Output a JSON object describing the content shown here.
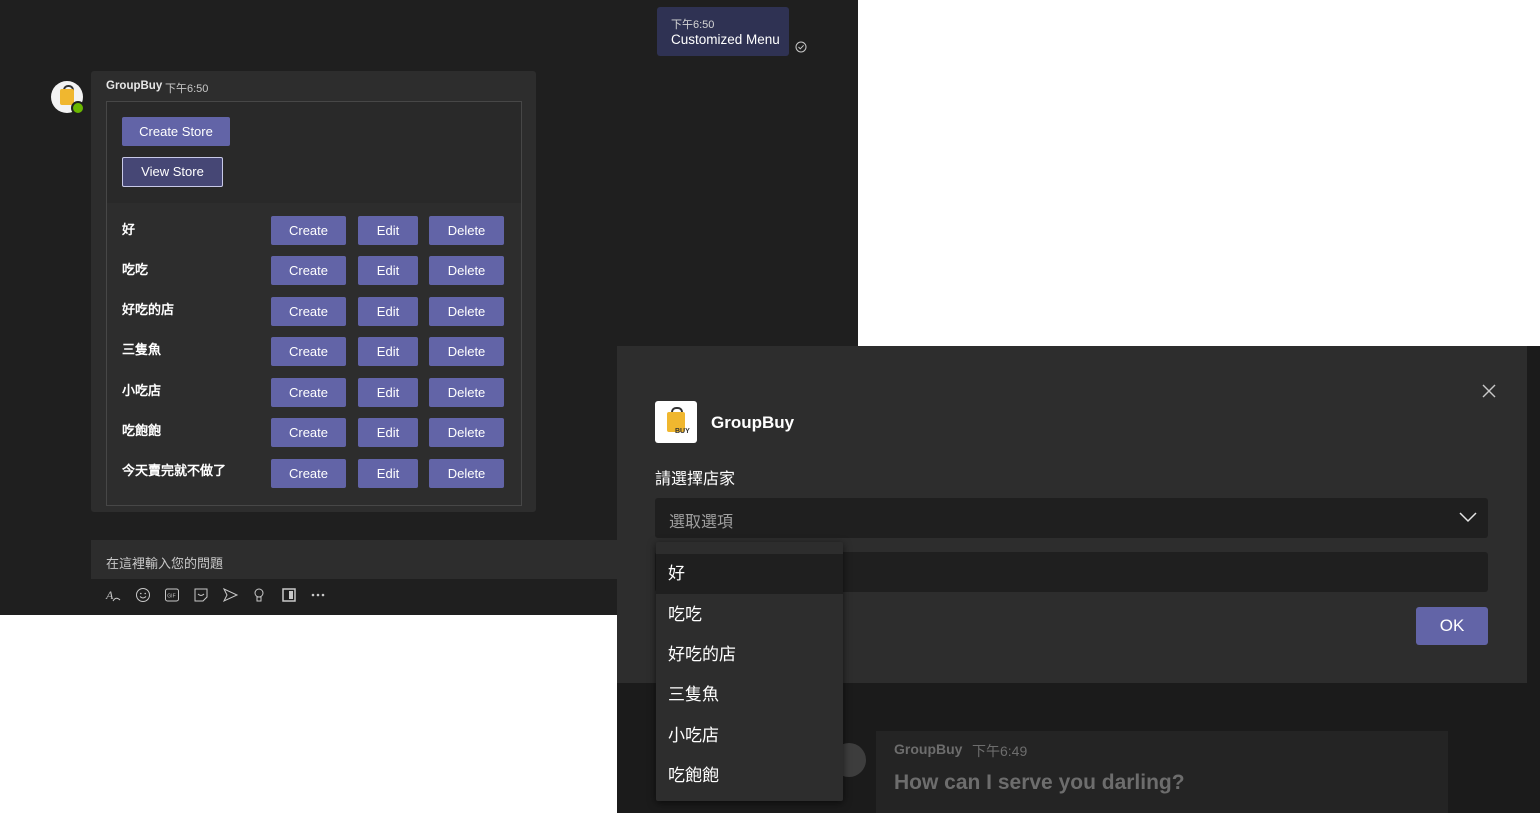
{
  "colors": {
    "accent": "#6264a7",
    "background": "#1f1f1f",
    "surface": "#2d2d2d",
    "status_online": "#6bb700"
  },
  "chat": {
    "sent_message": {
      "time": "下午6:50",
      "text": "Customized Menu",
      "status_icon": "read-check-icon"
    },
    "bot_message": {
      "sender": "GroupBuy",
      "time": "下午6:50",
      "card": {
        "create_store_label": "Create Store",
        "view_store_label": "View Store",
        "rows": [
          {
            "name": "好",
            "create": "Create",
            "edit": "Edit",
            "delete": "Delete"
          },
          {
            "name": "吃吃",
            "create": "Create",
            "edit": "Edit",
            "delete": "Delete"
          },
          {
            "name": "好吃的店",
            "create": "Create",
            "edit": "Edit",
            "delete": "Delete"
          },
          {
            "name": "三隻魚",
            "create": "Create",
            "edit": "Edit",
            "delete": "Delete"
          },
          {
            "name": "小吃店",
            "create": "Create",
            "edit": "Edit",
            "delete": "Delete"
          },
          {
            "name": "吃飽飽",
            "create": "Create",
            "edit": "Edit",
            "delete": "Delete"
          },
          {
            "name": "今天賣完就不做了",
            "create": "Create",
            "edit": "Edit",
            "delete": "Delete"
          }
        ]
      }
    },
    "compose": {
      "placeholder": "在這裡輸入您的問題"
    },
    "toolbar_icons": [
      "format-icon",
      "emoji-icon",
      "gif-icon",
      "sticker-icon",
      "meet-icon",
      "praise-icon",
      "app-icon",
      "more-options-icon"
    ]
  },
  "dialog": {
    "app_name": "GroupBuy",
    "icon_text": "BUY",
    "field_label": "請選擇店家",
    "select_placeholder": "選取選項",
    "ok_label": "OK",
    "options": [
      "好",
      "吃吃",
      "好吃的店",
      "三隻魚",
      "小吃店",
      "吃飽飽"
    ],
    "selected_option": "好"
  },
  "background_message": {
    "sender": "GroupBuy",
    "time": "下午6:49",
    "text": "How can I serve you darling?"
  }
}
